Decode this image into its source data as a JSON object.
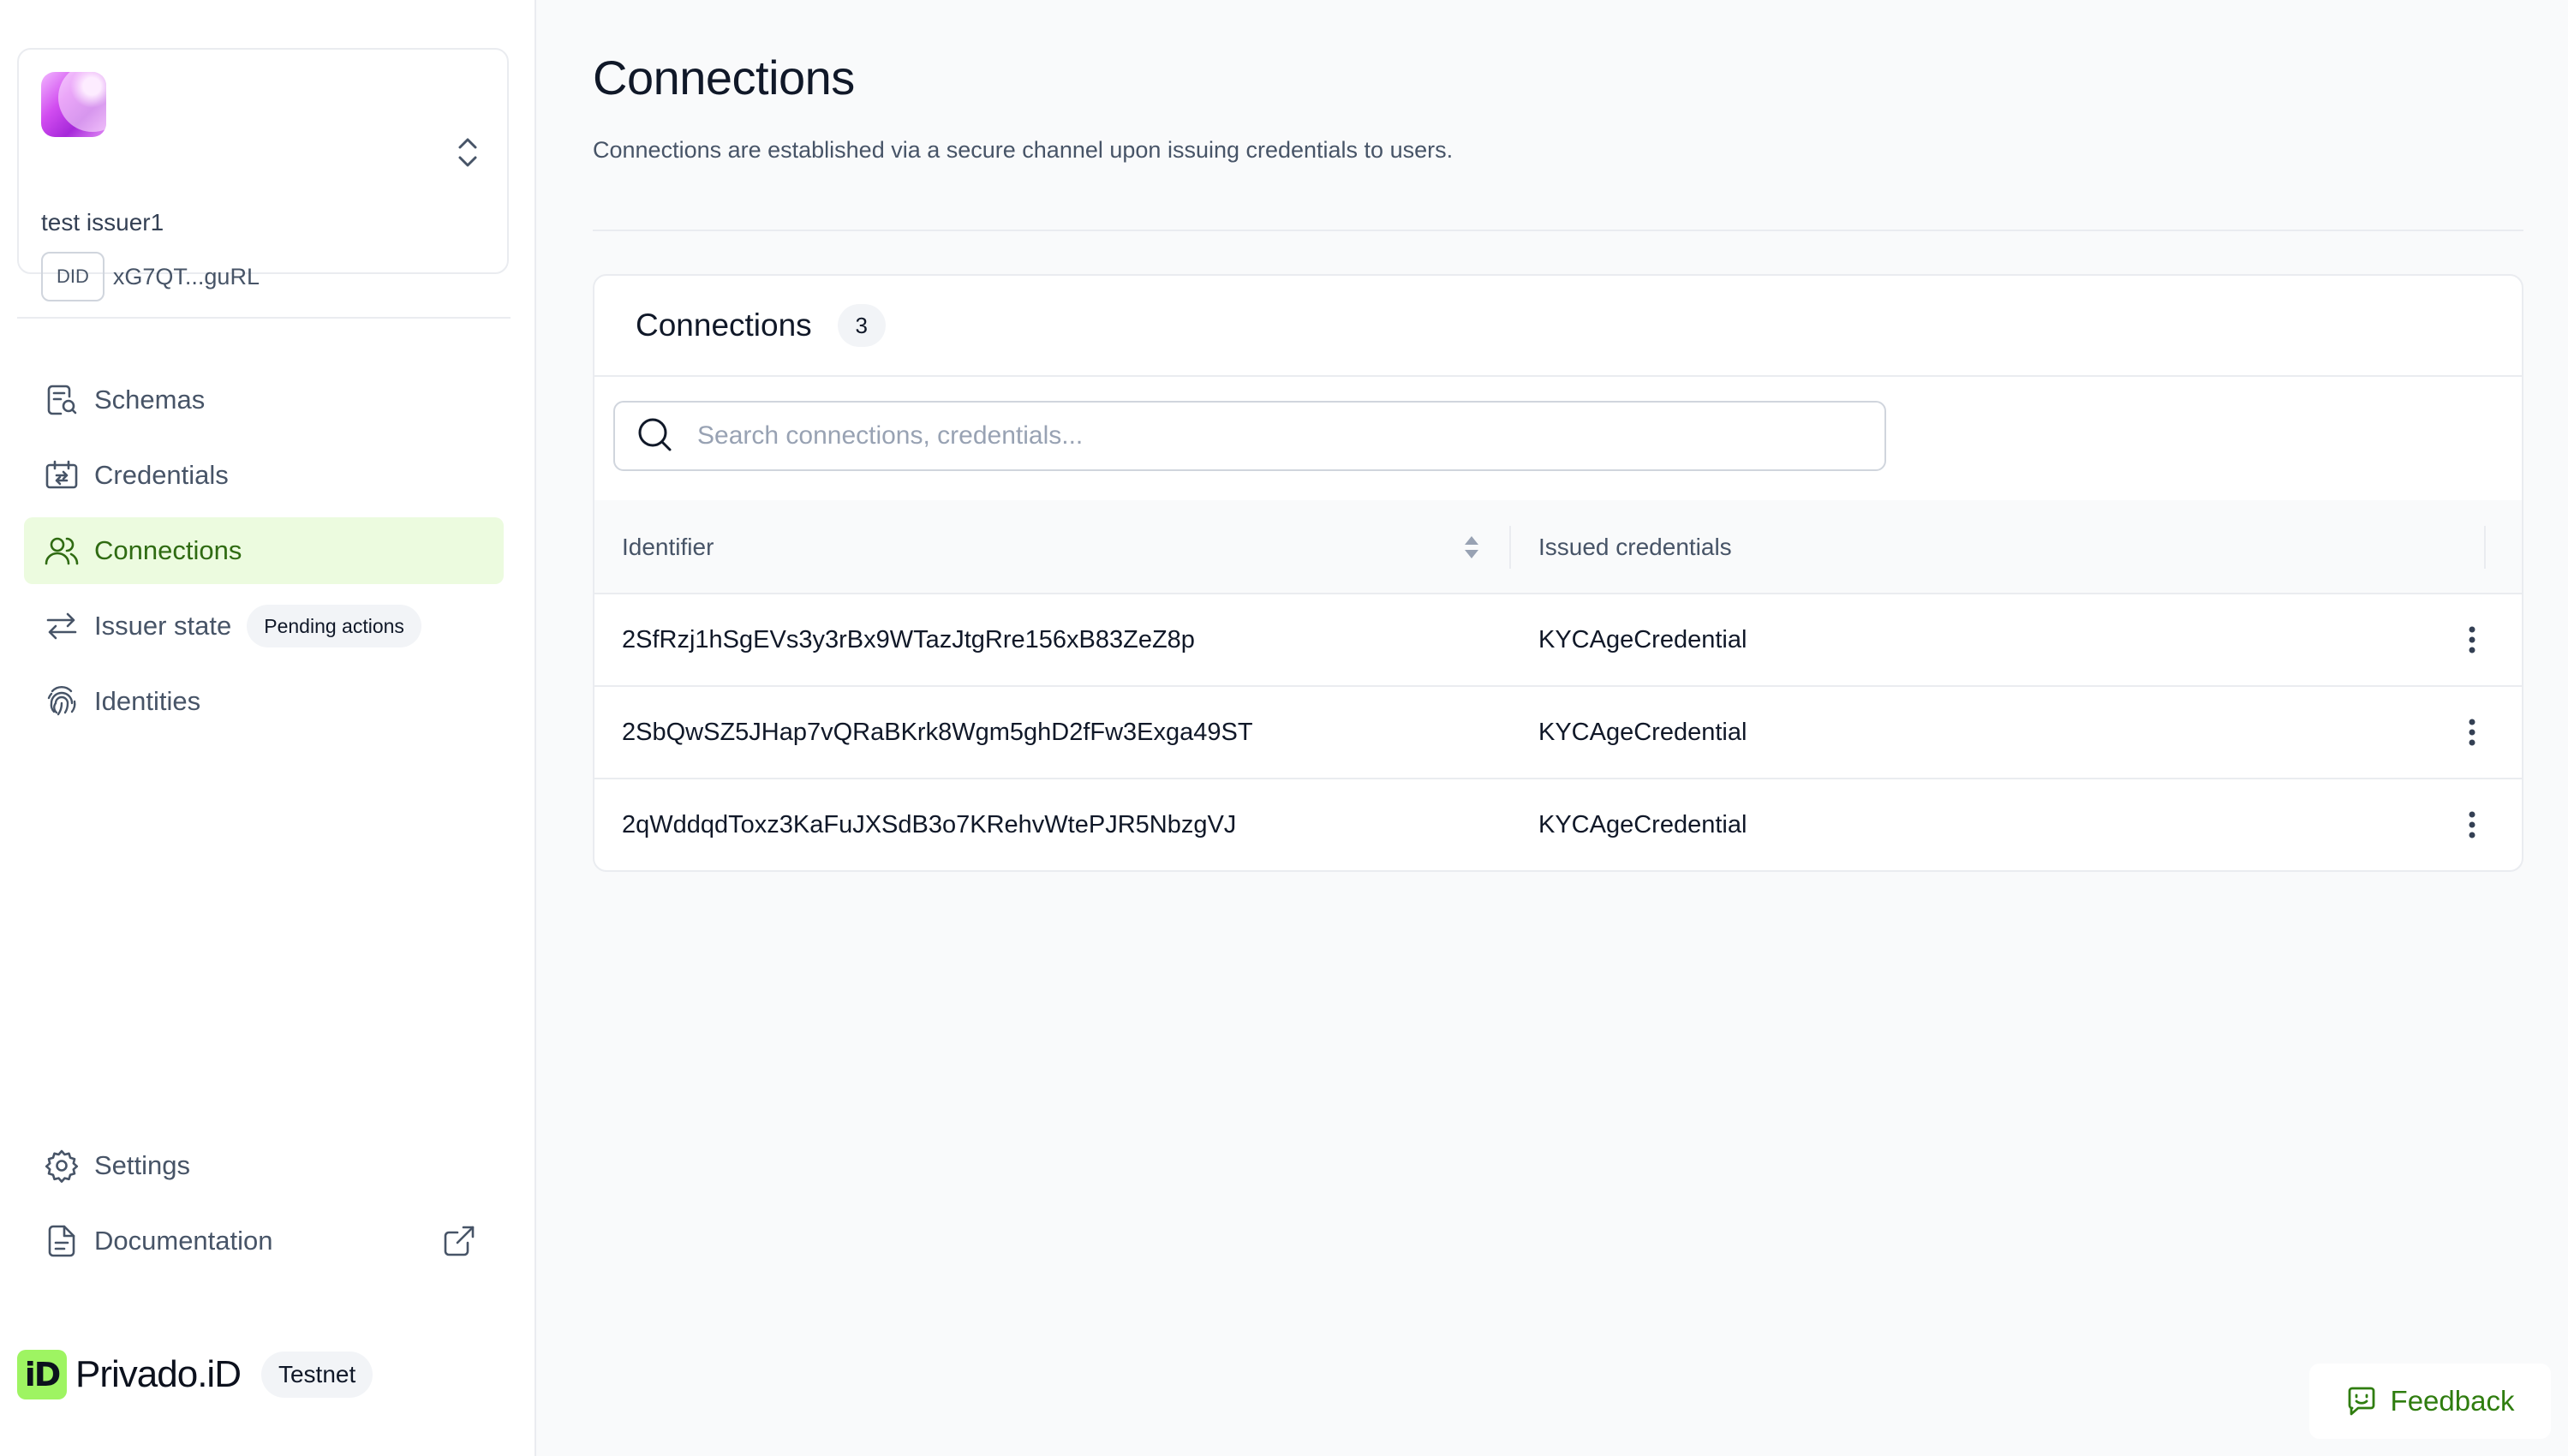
{
  "issuer": {
    "name": "test issuer1",
    "did_label": "DID",
    "did_value": "xG7QT...guRL"
  },
  "sidebar": {
    "items": [
      {
        "label": "Schemas",
        "icon": "schema-icon"
      },
      {
        "label": "Credentials",
        "icon": "credentials-icon"
      },
      {
        "label": "Connections",
        "icon": "users-icon",
        "active": true
      },
      {
        "label": "Issuer state",
        "icon": "switch-arrows-icon",
        "badge": "Pending actions"
      },
      {
        "label": "Identities",
        "icon": "fingerprint-icon"
      }
    ],
    "bottom": [
      {
        "label": "Settings",
        "icon": "gear-icon"
      },
      {
        "label": "Documentation",
        "icon": "document-icon"
      }
    ]
  },
  "brand": {
    "logo_text": "iD",
    "name": "Privado.iD",
    "network": "Testnet"
  },
  "page": {
    "title": "Connections",
    "subtitle": "Connections are established via a secure channel upon issuing credentials to users."
  },
  "connections_card": {
    "title": "Connections",
    "count": "3",
    "search_placeholder": "Search connections, credentials..."
  },
  "table": {
    "columns": [
      "Identifier",
      "Issued credentials"
    ],
    "rows": [
      {
        "identifier": "2SfRzj1hSgEVs3y3rBx9WTazJtgRre156xB83ZeZ8p",
        "credentials": "KYCAgeCredential"
      },
      {
        "identifier": "2SbQwSZ5JHap7vQRaBKrk8Wgm5ghD2fFw3Exga49ST",
        "credentials": "KYCAgeCredential"
      },
      {
        "identifier": "2qWddqdToxz3KaFuJXSdB3o7KRehvWtePJR5NbzgVJ",
        "credentials": "KYCAgeCredential"
      }
    ]
  },
  "feedback": {
    "label": "Feedback"
  },
  "colors": {
    "accent_green": "#2f6b12",
    "active_bg": "#ecfbdf",
    "brand_green": "#9ef462"
  }
}
